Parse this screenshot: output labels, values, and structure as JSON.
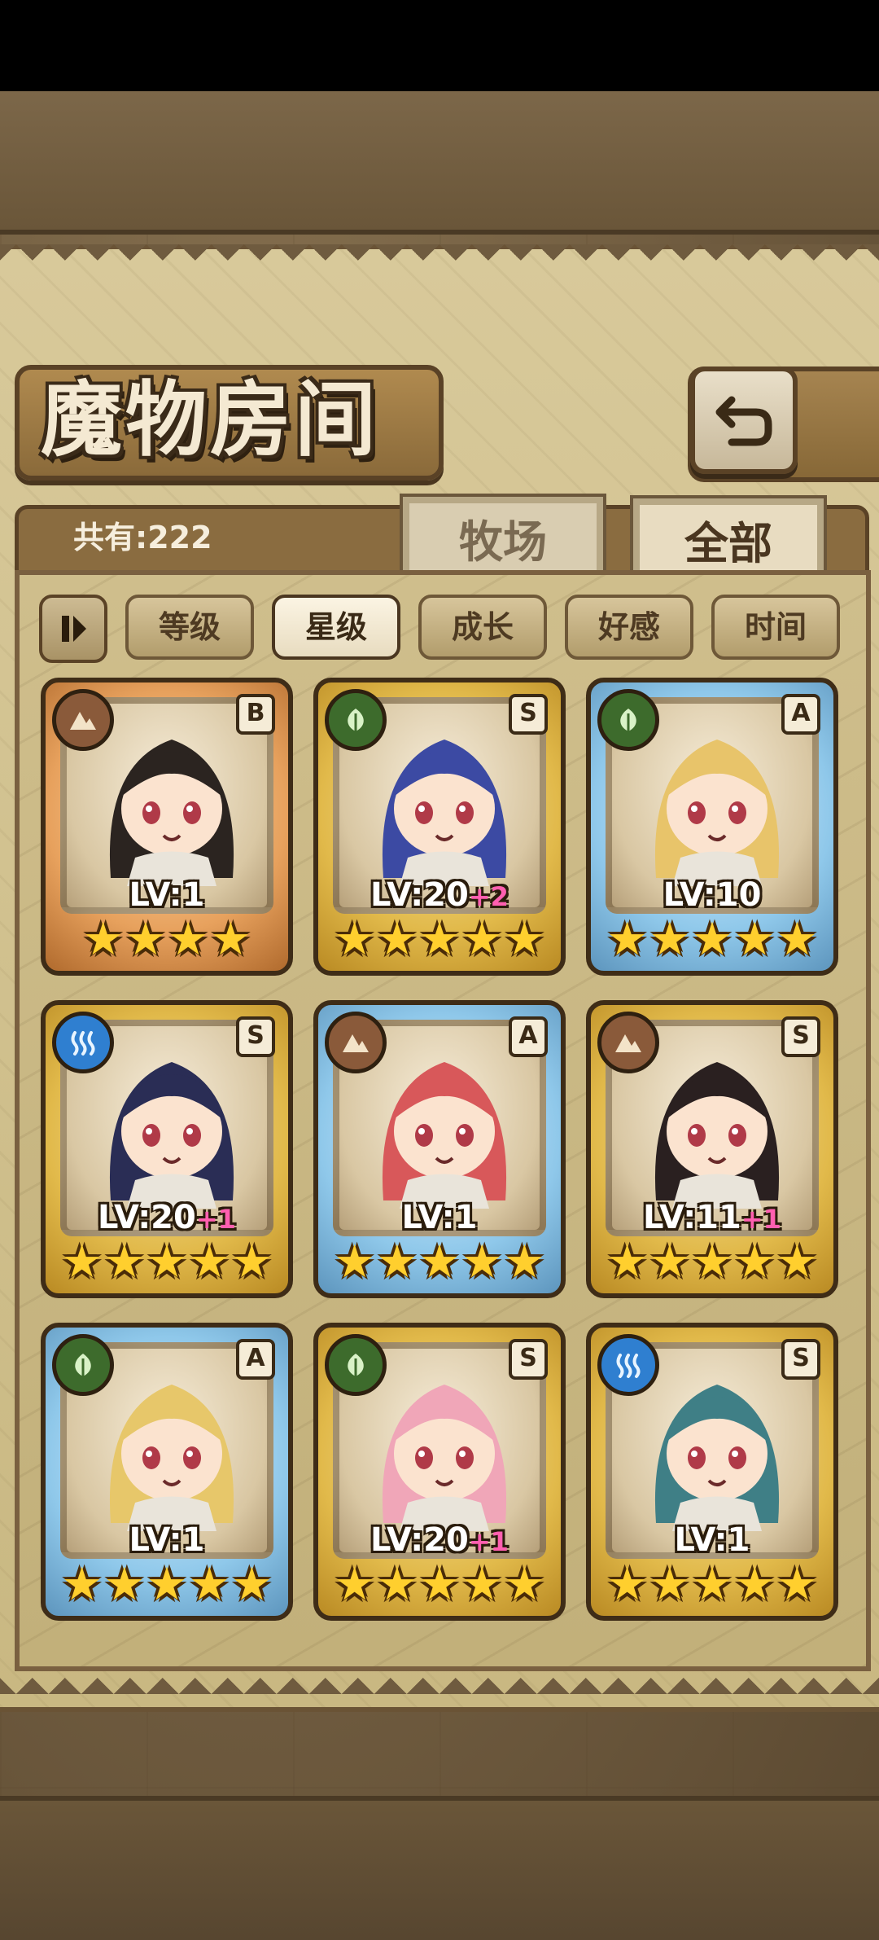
{
  "header": {
    "title": "魔物房间",
    "back_icon": "return-arrow-icon"
  },
  "summary": {
    "count_text": "共有:222"
  },
  "tabs": [
    {
      "label": "牧场",
      "active": false
    },
    {
      "label": "全部",
      "active": true
    }
  ],
  "sort": {
    "pause_icon": "pause-icon",
    "buttons": [
      {
        "label": "等级",
        "active": false
      },
      {
        "label": "星级",
        "active": true
      },
      {
        "label": "成长",
        "active": false
      },
      {
        "label": "好感",
        "active": false
      },
      {
        "label": "时间",
        "active": false
      }
    ]
  },
  "monsters": [
    {
      "level": "LV:1",
      "plus": "",
      "rank": "B",
      "element": "earth",
      "frame": "bronze",
      "stars": 4
    },
    {
      "level": "LV:20",
      "plus": "+2",
      "rank": "S",
      "element": "leaf",
      "frame": "gold",
      "stars": 5
    },
    {
      "level": "LV:10",
      "plus": "",
      "rank": "A",
      "element": "leaf",
      "frame": "blue",
      "stars": 5
    },
    {
      "level": "LV:20",
      "plus": "+1",
      "rank": "S",
      "element": "water",
      "frame": "gold",
      "stars": 5
    },
    {
      "level": "LV:1",
      "plus": "",
      "rank": "A",
      "element": "earth",
      "frame": "blue",
      "stars": 5
    },
    {
      "level": "LV:11",
      "plus": "+1",
      "rank": "S",
      "element": "earth",
      "frame": "gold",
      "stars": 5
    },
    {
      "level": "LV:1",
      "plus": "",
      "rank": "A",
      "element": "leaf",
      "frame": "blue",
      "stars": 5
    },
    {
      "level": "LV:20",
      "plus": "+1",
      "rank": "S",
      "element": "leaf",
      "frame": "gold",
      "stars": 5
    },
    {
      "level": "LV:1",
      "plus": "",
      "rank": "S",
      "element": "water",
      "frame": "gold",
      "stars": 5
    }
  ],
  "colors": {
    "star": "#ffcf2e",
    "plus": "#ff5fb0",
    "frame_gold": "#e1b94a",
    "frame_blue": "#8fc8ea",
    "frame_bronze": "#e7a15d"
  }
}
